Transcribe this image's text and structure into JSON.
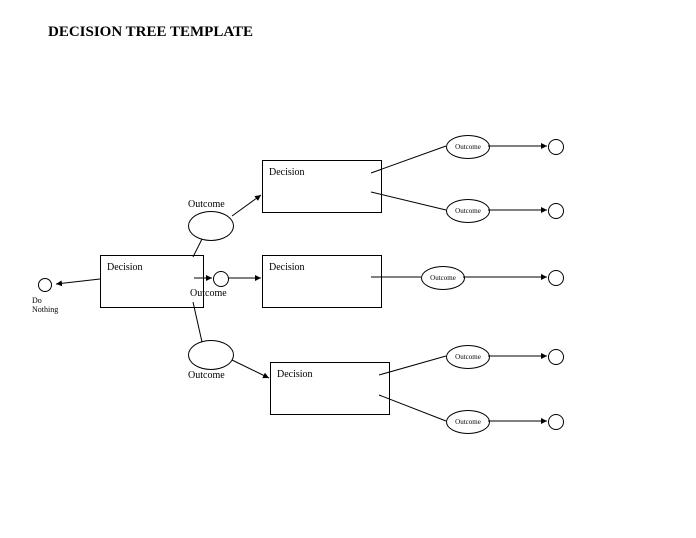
{
  "title": "DECISION TREE TEMPLATE",
  "root_terminal_label": "Do\nNothing",
  "root_decision": "Decision",
  "outcome_top_label": "Outcome",
  "outcome_mid_label": "Outcome",
  "outcome_bottom_label": "Outcome",
  "decision_a": "Decision",
  "decision_b": "Decision",
  "decision_c": "Decision",
  "a_outcome1": "Outcome",
  "a_outcome2": "Outcome",
  "b_outcome": "Outcome",
  "c_outcome1": "Outcome",
  "c_outcome2": "Outcome"
}
